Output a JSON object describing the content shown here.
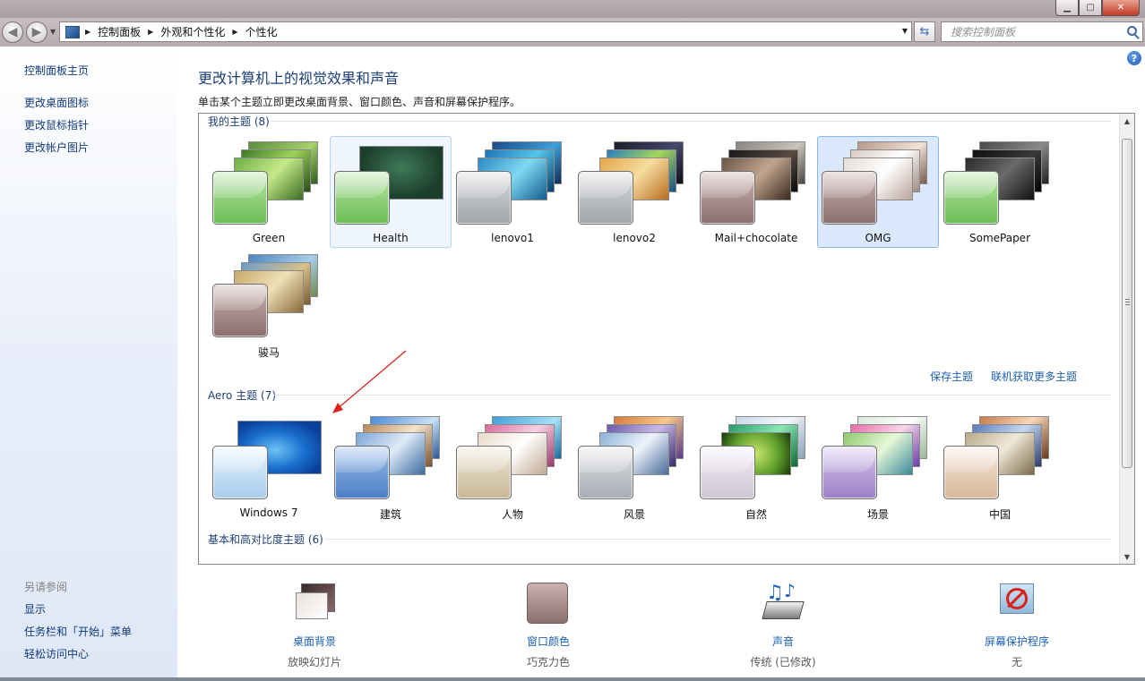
{
  "breadcrumb": [
    "控制面板",
    "外观和个性化",
    "个性化"
  ],
  "search": {
    "placeholder": "搜索控制面板"
  },
  "left": {
    "links": [
      "控制面板主页",
      "更改桌面图标",
      "更改鼠标指针",
      "更改帐户图片"
    ],
    "see_also_title": "另请参阅",
    "see_also": [
      "显示",
      "任务栏和「开始」菜单",
      "轻松访问中心"
    ]
  },
  "main": {
    "title": "更改计算机上的视觉效果和声音",
    "subtitle": "单击某个主题立即更改桌面背景、窗口颜色、声音和屏幕保护程序。"
  },
  "my_themes": {
    "header": "我的主题 (8)",
    "items": [
      "Green",
      "Health",
      "lenovo1",
      "lenovo2",
      "Mail+chocolate",
      "OMG",
      "SomePaper",
      "骏马"
    ],
    "save_link": "保存主题",
    "more_link": "联机获取更多主题"
  },
  "aero_themes": {
    "header": "Aero 主题 (7)",
    "items": [
      "Windows 7",
      "建筑",
      "人物",
      "风景",
      "自然",
      "场景",
      "中国"
    ]
  },
  "basic_themes": {
    "header": "基本和高对比度主题 (6)"
  },
  "bottom": {
    "desktop_bg": {
      "title": "桌面背景",
      "value": "放映幻灯片"
    },
    "window_color": {
      "title": "窗口颜色",
      "value": "巧克力色"
    },
    "sound": {
      "title": "声音",
      "value": "传统 (已修改)"
    },
    "screensaver": {
      "title": "屏幕保护程序",
      "value": "无"
    }
  },
  "colors": {
    "accent_link": "#1d5fb4",
    "title_blue": "#1b3f76",
    "selected_tile": "#d9e8fb"
  }
}
